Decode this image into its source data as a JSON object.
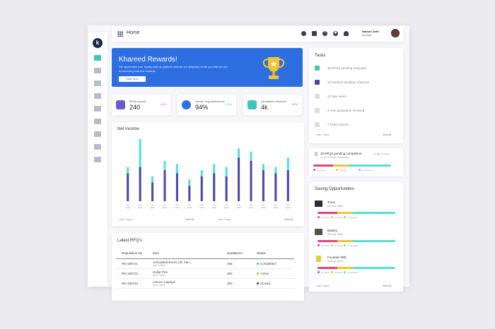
{
  "topbar": {
    "home": "Home",
    "user_name": "Haroon Seth",
    "user_role": "Manager",
    "icons": [
      "support-icon",
      "mail-icon",
      "help-icon",
      "settings-icon",
      "bell-icon"
    ]
  },
  "sidebar": {
    "logo": "k",
    "icons": [
      "dashboard-icon",
      "monitor-icon",
      "cart-icon",
      "inventory-icon",
      "document-icon",
      "list-icon",
      "report-icon",
      "tools-icon",
      "analytics-icon"
    ]
  },
  "banner": {
    "title": "Khareed Rewards!",
    "text": "We appreciate your loyalty with us platform and we are delighted to tell you that we are announcing khareed rewards.",
    "button": "Claim Now!"
  },
  "stats": [
    {
      "label": "RFQs Issued",
      "value": "240",
      "change": "-12%",
      "color": "#6a5acd",
      "change_color": "#e0457b"
    },
    {
      "label": "Vendor responsiveness",
      "value": "94%",
      "change": "+12%",
      "color": "#2d6fe0",
      "change_color": "#3ec6b9"
    },
    {
      "label": "Quotations received",
      "value": "4k",
      "change": "-12%",
      "color": "#3ec6b9",
      "change_color": "#e0457b"
    }
  ],
  "net_income": {
    "title": "Net Income",
    "filter": "Last 7 Days",
    "view_all": "View All",
    "filter2": "Last 7 Days",
    "view_all2": "View All"
  },
  "chart_data": {
    "type": "bar",
    "categories": [
      "Nov 2019",
      "Dec 2019",
      "Jan 2020",
      "Feb 2020",
      "Mar 2020",
      "Apr 2020",
      "May 2020",
      "Jun 2020",
      "Jul 2020",
      "Aug 2020",
      "Sep 2020",
      "Oct 2020",
      "Nov 2020",
      "Dec 2020"
    ],
    "series": [
      {
        "values": [
          45,
          55,
          30,
          50,
          45,
          25,
          40,
          45,
          40,
          70,
          65,
          50,
          45,
          50
        ],
        "color": "#5146a8"
      },
      {
        "values": [
          55,
          100,
          40,
          65,
          60,
          35,
          50,
          60,
          55,
          85,
          80,
          60,
          55,
          70
        ],
        "color": "#52e0d6"
      }
    ],
    "ylim": [
      0,
      100
    ]
  },
  "tasks": {
    "title": "Tasks",
    "items": [
      {
        "label": "30 RFQs pending response",
        "checked": true,
        "color": "#3ec6b9"
      },
      {
        "label": "10 vendors pending response",
        "checked": true,
        "color": "#5146a8"
      },
      {
        "label": "10 new users",
        "checked": false,
        "color": "#ddd"
      },
      {
        "label": "4 new quotations received",
        "checked": false,
        "color": "#ddd"
      },
      {
        "label": "7 Order placed",
        "checked": false,
        "color": "#ddd"
      }
    ],
    "filter": "Last 7 Days",
    "view_all": "View All"
  },
  "pending": {
    "title": "15 RFQs pending completion",
    "subtitle": "22 of 14 RFQs Completed",
    "due": "in last 2 hours",
    "legend": [
      "Not Done",
      "Pending",
      "Completed"
    ]
  },
  "saving": {
    "title": "Saving Opportunities",
    "items": [
      {
        "name": "Toner",
        "sub": "Savings: $565",
        "thumb": "#2b2e3a"
      },
      {
        "name": "Battery",
        "sub": "Savings: $565",
        "thumb": "#55504a"
      },
      {
        "name": "Fountain Milk",
        "sub": "Savings: $565",
        "thumb": "#e8cc3a"
      }
    ],
    "legend": [
      "Not Done",
      "Pending",
      "Completed"
    ],
    "filter": "Last 7 Days",
    "view_all": "View All"
  },
  "rfqs": {
    "title": "Latest RFQ's",
    "columns": [
      "Requisition No.",
      "Item",
      "Quotations",
      "Status"
    ],
    "rows": [
      {
        "no": "RN-190711",
        "item": "Articulated Boom Lift, Fan...",
        "more": "and 4 other",
        "quotes": "456",
        "status": "Completed",
        "color": "#3ec6b9"
      },
      {
        "no": "RN-190722",
        "item": "Dollar Pen",
        "more": "and 4 other",
        "quotes": "300",
        "status": "Active",
        "color": "#f5a623"
      },
      {
        "no": "RN-190733",
        "item": "Lenovo Laptops",
        "more": "and 4 other",
        "quotes": "300",
        "status": "Closed",
        "color": "#3c3f5a"
      }
    ]
  }
}
